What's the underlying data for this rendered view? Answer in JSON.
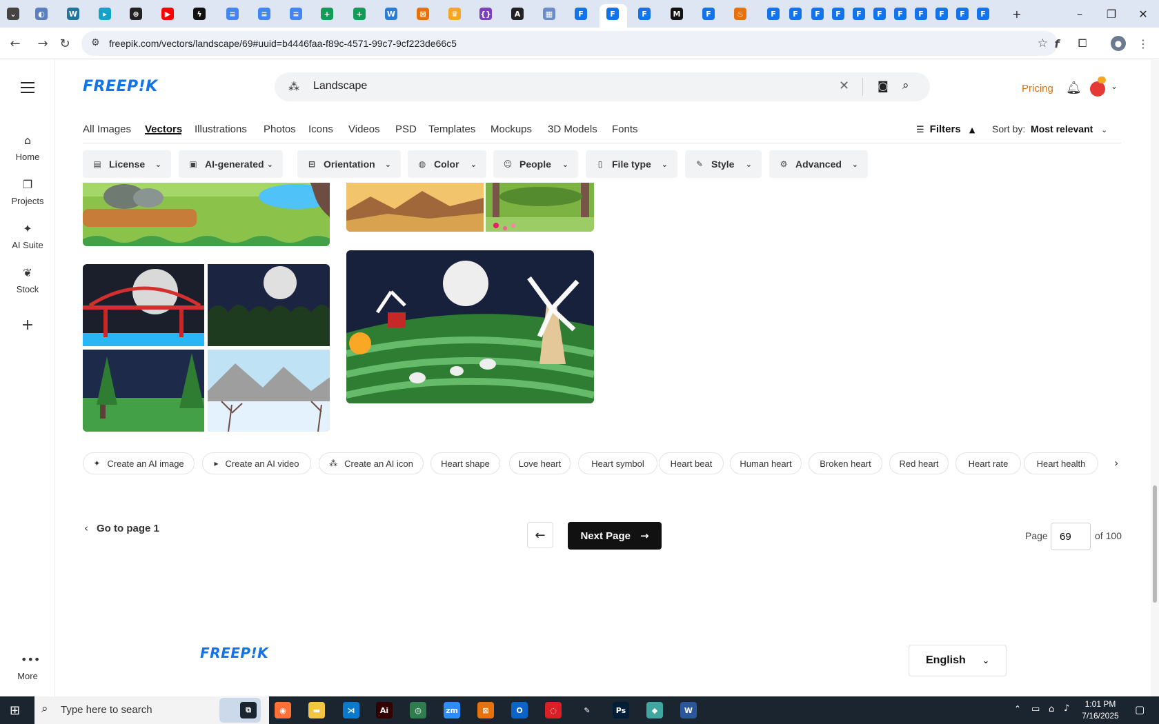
{
  "browser": {
    "url": "freepik.com/vectors/landscape/69#uuid=b4446faa-f89c-4571-99c7-9cf223de66c5",
    "tab_icons": [
      {
        "name": "chrome-menu-icon",
        "color": "#444444",
        "glyph": "⌄"
      },
      {
        "name": "browser-tab-icon",
        "color": "#5b7fbf",
        "glyph": "◐"
      },
      {
        "name": "wordpress-tab-icon",
        "color": "#21759b",
        "glyph": "W"
      },
      {
        "name": "app-tab-icon",
        "color": "#14a3c7",
        "glyph": "▸"
      },
      {
        "name": "chatgpt-tab-icon",
        "color": "#222222",
        "glyph": "⊛"
      },
      {
        "name": "youtube-tab-icon",
        "color": "#ff0000",
        "glyph": "▶"
      },
      {
        "name": "bolt-tab-icon",
        "color": "#111111",
        "glyph": "ϟ"
      },
      {
        "name": "docs-tab-icon",
        "color": "#4285f4",
        "glyph": "≡"
      },
      {
        "name": "docs-tab-icon",
        "color": "#4285f4",
        "glyph": "≡"
      },
      {
        "name": "docs-tab-icon",
        "color": "#4285f4",
        "glyph": "≡"
      },
      {
        "name": "sheets-tab-icon",
        "color": "#0f9d58",
        "glyph": "+"
      },
      {
        "name": "sheets-tab-icon",
        "color": "#0f9d58",
        "glyph": "+"
      },
      {
        "name": "word-tab-icon",
        "color": "#2b7cd3",
        "glyph": "W"
      },
      {
        "name": "app-tab-icon",
        "color": "#e8710a",
        "glyph": "⊠"
      },
      {
        "name": "crown-tab-icon",
        "color": "#f5a623",
        "glyph": "♛"
      },
      {
        "name": "code-tab-icon",
        "color": "#7e3fbf",
        "glyph": "{}"
      },
      {
        "name": "app-tab-icon",
        "color": "#222222",
        "glyph": "A"
      },
      {
        "name": "app-tab-icon",
        "color": "#6b8ec9",
        "glyph": "▦"
      },
      {
        "name": "freepik-tab-icon",
        "color": "#1273eb",
        "glyph": "F"
      },
      {
        "name": "freepik-tab-icon",
        "color": "#1273eb",
        "glyph": "F"
      },
      {
        "name": "freepik-tab-icon",
        "color": "#1273eb",
        "glyph": "F"
      },
      {
        "name": "medium-tab-icon",
        "color": "#111111",
        "glyph": "M"
      },
      {
        "name": "freepik-tab-icon",
        "color": "#1273eb",
        "glyph": "F"
      },
      {
        "name": "app-tab-icon",
        "color": "#e8710a",
        "glyph": "♨"
      },
      {
        "name": "freepik-tab-icon",
        "color": "#1273eb",
        "glyph": "F"
      },
      {
        "name": "freepik-tab-icon",
        "color": "#1273eb",
        "glyph": "F"
      },
      {
        "name": "freepik-tab-icon",
        "color": "#1273eb",
        "glyph": "F"
      },
      {
        "name": "freepik-tab-icon",
        "color": "#1273eb",
        "glyph": "F"
      },
      {
        "name": "freepik-tab-icon",
        "color": "#1273eb",
        "glyph": "F"
      },
      {
        "name": "freepik-tab-icon",
        "color": "#1273eb",
        "glyph": "F"
      },
      {
        "name": "freepik-tab-icon",
        "color": "#1273eb",
        "glyph": "F"
      },
      {
        "name": "freepik-tab-icon",
        "color": "#1273eb",
        "glyph": "F"
      },
      {
        "name": "freepik-tab-icon",
        "color": "#1273eb",
        "glyph": "F"
      },
      {
        "name": "freepik-tab-icon",
        "color": "#1273eb",
        "glyph": "F"
      },
      {
        "name": "freepik-tab-icon",
        "color": "#1273eb",
        "glyph": "F"
      }
    ]
  },
  "site": {
    "logo": "FREEP!K",
    "search_value": "Landscape",
    "pricing": "Pricing",
    "nav": [
      {
        "label": "Home",
        "icon": "home-icon"
      },
      {
        "label": "Projects",
        "icon": "projects-icon"
      },
      {
        "label": "AI Suite",
        "icon": "sparkle-icon"
      },
      {
        "label": "Stock",
        "icon": "stock-icon"
      }
    ],
    "more": "More",
    "category_tabs": [
      "All Images",
      "Vectors",
      "Illustrations",
      "Photos",
      "Icons",
      "Videos",
      "PSD",
      "Templates",
      "Mockups",
      "3D Models",
      "Fonts"
    ],
    "active_tab": "Vectors",
    "filters_label": "Filters",
    "sort_label": "Sort by:",
    "sort_value": "Most relevant",
    "filter_chips": [
      "License",
      "AI-generated",
      "Orientation",
      "Color",
      "People",
      "File type",
      "Style",
      "Advanced"
    ],
    "related": [
      "Create an AI image",
      "Create an AI video",
      "Create an AI icon",
      "Heart shape",
      "Love heart",
      "Heart symbol",
      "Heart beat",
      "Human heart",
      "Broken heart",
      "Red heart",
      "Heart rate",
      "Heart health"
    ],
    "pagination": {
      "go_to_first": "Go to page 1",
      "next": "Next Page",
      "page_label": "Page",
      "current_page": "69",
      "of_label": "of 100"
    },
    "language": "English"
  },
  "taskbar": {
    "search_placeholder": "Type here to search",
    "time": "1:01 PM",
    "date": "7/16/2025",
    "apps": [
      {
        "name": "task-view-icon",
        "color": "#1b2530",
        "glyph": "⧉"
      },
      {
        "name": "firefox-icon",
        "color": "#ff7139",
        "glyph": "◉"
      },
      {
        "name": "file-explorer-icon",
        "color": "#f4c542",
        "glyph": "▬"
      },
      {
        "name": "vscode-icon",
        "color": "#0a7acc",
        "glyph": "⋊"
      },
      {
        "name": "illustrator-icon",
        "color": "#330000",
        "glyph": "Ai"
      },
      {
        "name": "chrome-icon",
        "color": "#2f7d4f",
        "glyph": "◎"
      },
      {
        "name": "zoom-icon",
        "color": "#2d8cff",
        "glyph": "zm"
      },
      {
        "name": "app-icon",
        "color": "#e8710a",
        "glyph": "⊠"
      },
      {
        "name": "outlook-icon",
        "color": "#0a64c8",
        "glyph": "O"
      },
      {
        "name": "creative-cloud-icon",
        "color": "#da1f26",
        "glyph": "◌"
      },
      {
        "name": "pen-icon",
        "color": "#1b2530",
        "glyph": "✎"
      },
      {
        "name": "photoshop-icon",
        "color": "#001e36",
        "glyph": "Ps"
      },
      {
        "name": "app-icon",
        "color": "#3fa7a0",
        "glyph": "◆"
      },
      {
        "name": "word-icon",
        "color": "#2b579a",
        "glyph": "W"
      }
    ]
  }
}
